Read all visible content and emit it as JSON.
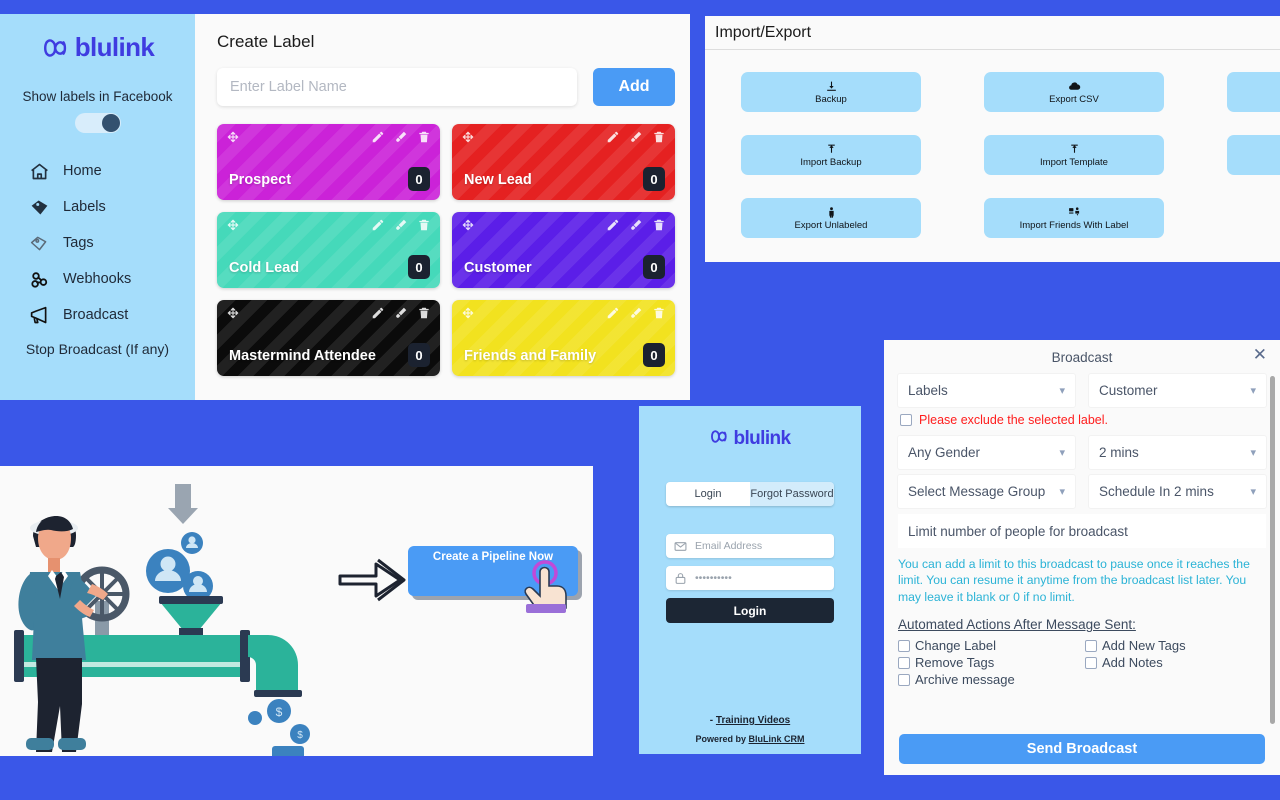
{
  "colors": {
    "page_background": "#3a57e8",
    "panel_light_blue": "#a5ddfb",
    "accent_blue": "#4a9bf5",
    "logo_purple": "#3f3ce0",
    "warning_red": "#ff1d1d",
    "note_cyan": "#2bb3d6"
  },
  "sidebar": {
    "logo_text": "blulink",
    "logo_icon": "blulink-knot-logo",
    "toggle_caption": "Show labels in Facebook",
    "toggle_state": "on",
    "items": [
      {
        "label": "Home",
        "icon": "home-icon"
      },
      {
        "label": "Labels",
        "icon": "tag-icon"
      },
      {
        "label": "Tags",
        "icon": "tags-outline-icon"
      },
      {
        "label": "Webhooks",
        "icon": "webhook-icon"
      },
      {
        "label": "Broadcast",
        "icon": "megaphone-icon"
      }
    ],
    "stop_broadcast": "Stop Broadcast (If any)"
  },
  "create_label": {
    "title": "Create Label",
    "input_placeholder": "Enter Label Name",
    "input_value": "",
    "add_label": "Add",
    "card_tools": [
      "move-icon",
      "pencil-icon",
      "brush-icon",
      "trash-icon"
    ],
    "cards": [
      {
        "name": "Prospect",
        "count": "0",
        "color": "#cb22d8"
      },
      {
        "name": "New Lead",
        "count": "0",
        "color": "#e52121"
      },
      {
        "name": "Cold Lead",
        "count": "0",
        "color": "#45d9ba"
      },
      {
        "name": "Customer",
        "count": "0",
        "color": "#5b1ee8"
      },
      {
        "name": "Mastermind Attendee",
        "count": "0",
        "color": "#0b0b0b"
      },
      {
        "name": "Friends and Family",
        "count": "0",
        "color": "#f2e21f"
      }
    ]
  },
  "import_export": {
    "title": "Import/Export",
    "buttons": [
      {
        "label": "Backup",
        "icon": "download-icon"
      },
      {
        "label": "Export CSV",
        "icon": "cloud-icon"
      },
      {
        "label": "",
        "icon": ""
      },
      {
        "label": "Import Backup",
        "icon": "upload-icon"
      },
      {
        "label": "Import Template",
        "icon": "upload-icon"
      },
      {
        "label": "",
        "icon": ""
      },
      {
        "label": "Export Unlabeled",
        "icon": "person-icon"
      },
      {
        "label": "Import Friends With Label",
        "icon": "people-import-icon"
      }
    ]
  },
  "illustration": {
    "cta_label": "Create a Pipeline Now",
    "alt": "man turning valve on pipeline funneling contacts into money"
  },
  "login": {
    "logo_text": "blulink",
    "tabs": [
      {
        "label": "Login",
        "active": true
      },
      {
        "label": "Forgot Password",
        "active": false
      }
    ],
    "email_placeholder": "Email Address",
    "password_value": "••••••••••",
    "submit_label": "Login",
    "training_prefix": "- ",
    "training_link": "Training Videos",
    "powered_prefix": "Powered by ",
    "powered_link": "BluLink CRM"
  },
  "broadcast": {
    "title": "Broadcast",
    "close_icon": "close-icon",
    "selects": [
      {
        "value": "Labels"
      },
      {
        "value": "Customer"
      },
      {
        "value": "Any Gender"
      },
      {
        "value": "2 mins"
      },
      {
        "value": "Select Message Group"
      },
      {
        "value": "Schedule In 2 mins"
      }
    ],
    "exclude_checkbox_label": "Please exclude the selected label.",
    "exclude_checked": false,
    "limit_placeholder": "Limit number of people for broadcast",
    "note": "You can add a limit to this broadcast to pause once it reaches the limit. You can resume it anytime from the broadcast list later. You may leave it blank or 0 if no limit.",
    "actions_title": "Automated Actions After Message Sent:",
    "actions": [
      {
        "label": "Change Label",
        "checked": false
      },
      {
        "label": "Add New Tags",
        "checked": false
      },
      {
        "label": "Remove Tags",
        "checked": false
      },
      {
        "label": "Add Notes",
        "checked": false
      },
      {
        "label": "Archive message",
        "checked": false
      }
    ],
    "send_label": "Send Broadcast"
  }
}
